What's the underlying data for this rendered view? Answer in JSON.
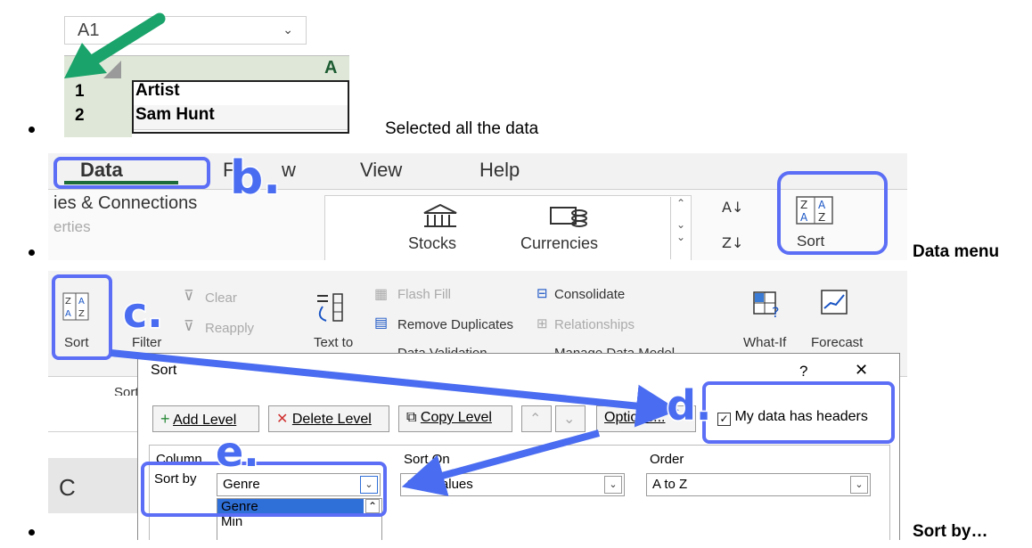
{
  "step1": {
    "name_box": "A1",
    "column_header": "A",
    "rows": [
      {
        "num": "1",
        "value": "Artist"
      },
      {
        "num": "2",
        "value": "Sam Hunt"
      }
    ],
    "caption": "Selected all the data"
  },
  "step2": {
    "tabs": [
      "Data",
      "F",
      "w",
      "View",
      "Help"
    ],
    "group_label": "ies & Connections",
    "group_sub": "erties",
    "stocks_label": "Stocks",
    "currencies_label": "Currencies",
    "sort_label": "Sort",
    "marker_b": "b.",
    "caption": "Data menu"
  },
  "step3": {
    "ribbon": {
      "sort_label": "Sort",
      "filter_label": "Filter",
      "clear_label": "Clear",
      "reapply_label": "Reapply",
      "text_to_label": "Text to",
      "flash_fill_label": "Flash Fill",
      "remove_duplicates_label": "Remove Duplicates",
      "data_validation_label": "Data Validation",
      "consolidate_label": "Consolidate",
      "relationships_label": "Relationships",
      "manage_data_model_label": "Manage Data Model",
      "whatif_label": "What-If",
      "forecast_label": "Forecast",
      "sort_group_label": "Sort"
    },
    "dialog": {
      "title": "Sort",
      "help": "?",
      "close": "✕",
      "add_level": "Add Level",
      "delete_level": "Delete Level",
      "copy_level": "Copy Level",
      "options": "Options...",
      "headers_checkbox_label": "My data has headers",
      "headers_checked": true,
      "col_header_column": "Column",
      "col_header_sort_on": "Sort On",
      "col_header_order": "Order",
      "row_label": "Sort by",
      "sort_by_value": "Genre",
      "sort_on_value": "Cell Values",
      "order_value": "A to Z",
      "dropdown_options": [
        "Genre",
        "Min"
      ]
    },
    "markers": {
      "c": "c.",
      "d": "d.",
      "e": "e."
    },
    "caption": "Sort by…"
  },
  "colors": {
    "accent_blue": "#5b6ef5",
    "excel_green": "#1d6b39"
  }
}
